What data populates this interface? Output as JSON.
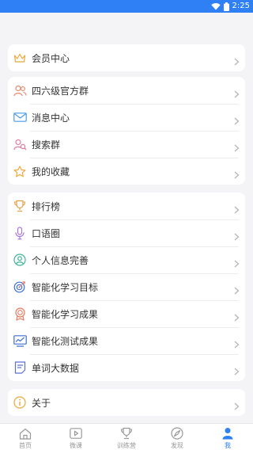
{
  "status": {
    "time": "2:25"
  },
  "sections": [
    {
      "items": [
        {
          "label": "会员中心",
          "icon": "crown-icon"
        }
      ]
    },
    {
      "items": [
        {
          "label": "四六级官方群",
          "icon": "users-icon"
        },
        {
          "label": "消息中心",
          "icon": "mail-icon"
        },
        {
          "label": "搜索群",
          "icon": "search-users-icon"
        },
        {
          "label": "我的收藏",
          "icon": "star-icon"
        }
      ]
    },
    {
      "items": [
        {
          "label": "排行榜",
          "icon": "trophy-icon"
        },
        {
          "label": "口语圈",
          "icon": "microphone-icon"
        },
        {
          "label": "个人信息完善",
          "icon": "profile-icon"
        },
        {
          "label": "智能化学习目标",
          "icon": "target-icon"
        },
        {
          "label": "智能化学习成果",
          "icon": "medal-icon"
        },
        {
          "label": "智能化测试成果",
          "icon": "chart-icon"
        },
        {
          "label": "单词大数据",
          "icon": "document-icon"
        }
      ]
    },
    {
      "items": [
        {
          "label": "关于",
          "icon": "info-icon"
        }
      ]
    }
  ],
  "tabs": [
    {
      "label": "首页",
      "icon": "home-icon"
    },
    {
      "label": "微课",
      "icon": "video-icon"
    },
    {
      "label": "训练营",
      "icon": "trophy-icon"
    },
    {
      "label": "发现",
      "icon": "compass-icon"
    },
    {
      "label": "我",
      "icon": "user-icon",
      "active": true
    }
  ],
  "colors": {
    "accent": "#2f80f5",
    "background": "#f4f4f6"
  }
}
